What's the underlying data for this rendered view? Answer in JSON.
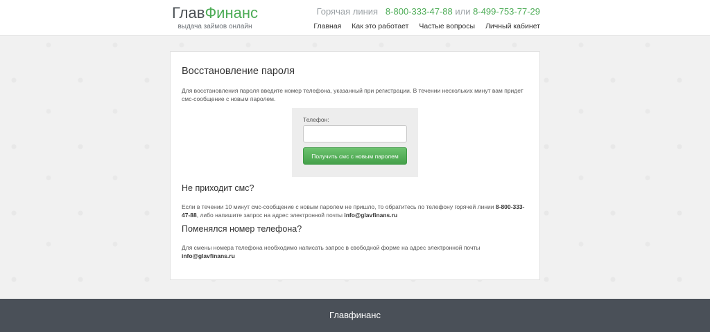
{
  "header": {
    "logo": {
      "part1": "Глав",
      "part2": "Финанс",
      "subtitle": "выдача займов онлайн"
    },
    "hotline": {
      "label": "Горячая линия",
      "phone1": "8-800-333-47-88",
      "or": "или",
      "phone2": "8-499-753-77-29"
    },
    "nav": [
      {
        "label": "Главная"
      },
      {
        "label": "Как это работает"
      },
      {
        "label": "Частые вопросы"
      },
      {
        "label": "Личный кабинет"
      }
    ]
  },
  "main": {
    "title": "Восстановление пароля",
    "intro": "Для восстановления пароля введите номер телефона, указанный при регистрации. В течении нескольких минут вам придет смс-сообщение с новым паролем.",
    "form": {
      "phone_label": "Телефон:",
      "phone_value": "",
      "submit_label": "Получить смс с новым паролем"
    },
    "no_sms": {
      "title": "Не приходит смс?",
      "text_before": "Если в течении 10 минут смс-сообщение с новым паролем не пришло, то обратитесь по телефону горячей линии",
      "phone": "8-800-333-47-88",
      "text_middle": ", либо напишите запрос на адрес электронной почты",
      "email": "info@glavfinans.ru"
    },
    "phone_changed": {
      "title": "Поменялся номер телефона?",
      "text": "Для смены номера телефона необходимо написать запрос в свободной форме на адрес электронной почты",
      "email": "info@glavfinans.ru"
    }
  },
  "footer": {
    "text": "Главфинанс"
  },
  "colors": {
    "accent": "#4dac56",
    "footer_bg": "#4a5058",
    "page_bg": "#f1f1f1"
  }
}
